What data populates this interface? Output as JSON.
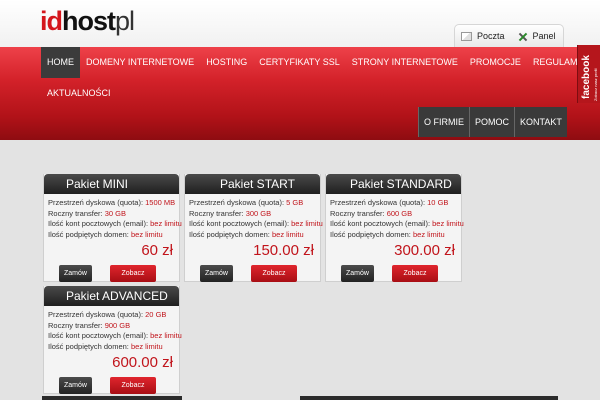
{
  "logo": {
    "part1": "id",
    "part2": "host",
    "part3": "pl"
  },
  "top_links": [
    {
      "label": "Poczta",
      "icon": "mail-icon"
    },
    {
      "label": "Panel",
      "icon": "tools-icon"
    }
  ],
  "nav": {
    "items": [
      "HOME",
      "DOMENY INTERNETOWE",
      "HOSTING",
      "CERTYFIKATY SSL",
      "STRONY INTERNETOWE",
      "PROMOCJE",
      "REGULAMIN"
    ],
    "row2": "AKTUALNOŚCI",
    "sub": [
      "O FIRMIE",
      "POMOC",
      "KONTAKT"
    ]
  },
  "facebook": {
    "label": "facebook",
    "sub": "Zobacz nasz profil"
  },
  "labels": {
    "quota": "Przestrzeń dyskowa (quota):",
    "transfer": "Roczny transfer:",
    "emails": "Ilość kont pocztowych (email):",
    "domains": "Ilość podpiętych domen:",
    "order": "Zamów",
    "view": "Zobacz"
  },
  "packages": [
    {
      "name": "Pakiet MINI",
      "quota": "1500 MB",
      "transfer": "30 GB",
      "emails": "bez limitu",
      "domains": "bez limitu",
      "price": "60 zł"
    },
    {
      "name": "Pakiet START",
      "quota": "5 GB",
      "transfer": "300 GB",
      "emails": "bez limitu",
      "domains": "bez limitu",
      "price": "150.00 zł"
    },
    {
      "name": "Pakiet STANDARD",
      "quota": "10 GB",
      "transfer": "600 GB",
      "emails": "bez limitu",
      "domains": "bez limitu",
      "price": "300.00 zł"
    },
    {
      "name": "Pakiet ADVANCED",
      "quota": "20 GB",
      "transfer": "900 GB",
      "emails": "bez limitu",
      "domains": "bez limitu",
      "price": "600.00 zł"
    }
  ],
  "colors": {
    "brand_red": "#d4161c",
    "dark": "#2b2b2b",
    "price_red": "#c1141b"
  }
}
